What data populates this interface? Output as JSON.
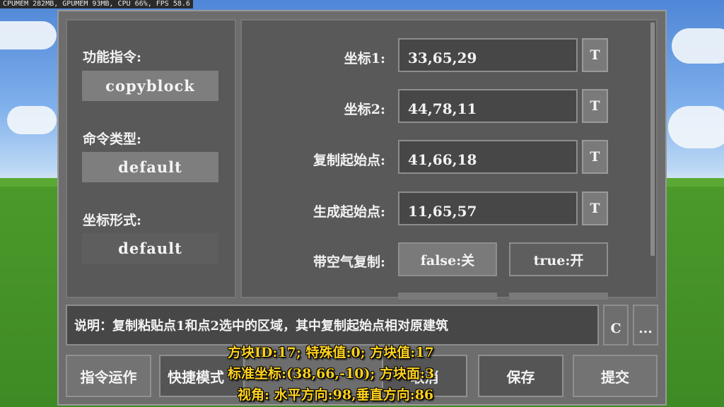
{
  "hud": {
    "stats": "CPUMEM 282MB, GPUMEM 93MB, CPU 66%, FPS 58.6"
  },
  "left": {
    "function_label": "功能指令:",
    "function_value": "copyblock",
    "type_label": "命令类型:",
    "type_value": "default",
    "coord_format_label": "坐标形式:",
    "coord_format_value": "default"
  },
  "fields": [
    {
      "label": "坐标1:",
      "value": "33,65,29",
      "button": "T"
    },
    {
      "label": "坐标2:",
      "value": "44,78,11",
      "button": "T"
    },
    {
      "label": "复制起始点:",
      "value": "41,66,18",
      "button": "T"
    },
    {
      "label": "生成起始点:",
      "value": "11,65,57",
      "button": "T"
    }
  ],
  "air_copy": {
    "label": "带空气复制:",
    "false_option": "false:关",
    "true_option": "true:开"
  },
  "description": {
    "text": "说明：复制粘贴点1和点2选中的区域，其中复制起始点相对原建筑",
    "c_button": "C",
    "more_button": "..."
  },
  "bottom": {
    "run_label": "指令运作",
    "quick_label": "快捷模式",
    "cancel_label": "取消",
    "save_label": "保存",
    "submit_label": "提交"
  },
  "overlay": {
    "line1": "方块ID:17; 特殊值:0; 方块值:17",
    "line2": "标准坐标:(38,66,-10); 方块面:3",
    "line3": "视角: 水平方向:98,垂直方向:86"
  },
  "colors": {
    "overlay_text": "#ffd21e",
    "panel": "#595959",
    "input_bg": "#474747"
  }
}
